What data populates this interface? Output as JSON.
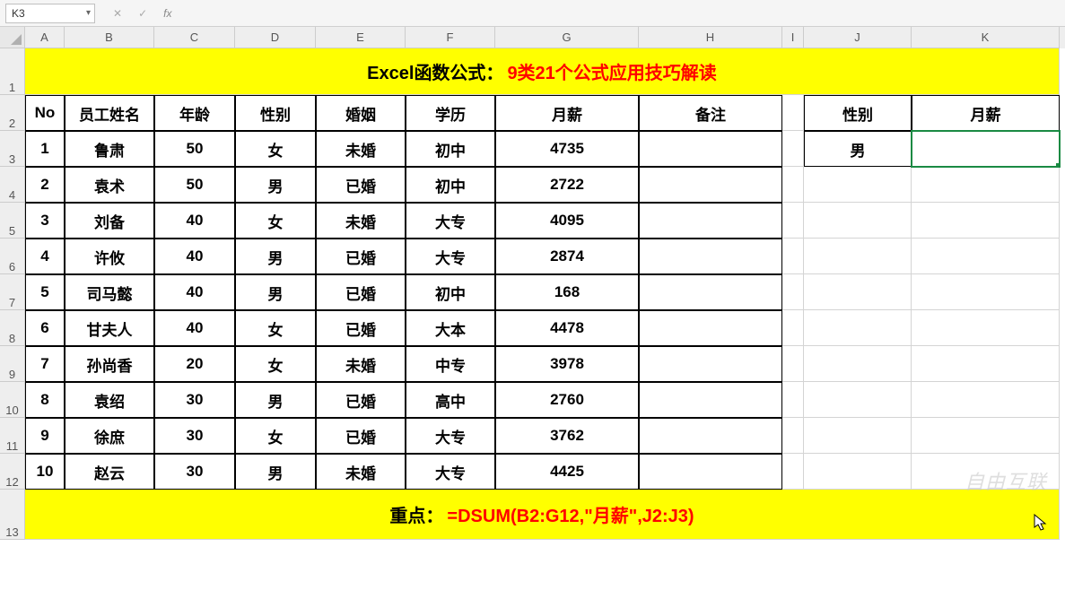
{
  "name_box": "K3",
  "banner": {
    "left": "Excel函数公式：",
    "right": "9类21个公式应用技巧解读"
  },
  "columns": [
    "A",
    "B",
    "C",
    "D",
    "E",
    "F",
    "G",
    "H",
    "I",
    "J",
    "K"
  ],
  "row_labels": [
    "1",
    "2",
    "3",
    "4",
    "5",
    "6",
    "7",
    "8",
    "9",
    "10",
    "11",
    "12",
    "13"
  ],
  "headers": {
    "A": "No",
    "B": "员工姓名",
    "C": "年龄",
    "D": "性别",
    "E": "婚姻",
    "F": "学历",
    "G": "月薪",
    "H": "备注"
  },
  "side_headers": {
    "J": "性别",
    "K": "月薪"
  },
  "side_value": "男",
  "data": [
    {
      "no": "1",
      "name": "鲁肃",
      "age": "50",
      "sex": "女",
      "mar": "未婚",
      "edu": "初中",
      "sal": "4735",
      "note": ""
    },
    {
      "no": "2",
      "name": "袁术",
      "age": "50",
      "sex": "男",
      "mar": "已婚",
      "edu": "初中",
      "sal": "2722",
      "note": ""
    },
    {
      "no": "3",
      "name": "刘备",
      "age": "40",
      "sex": "女",
      "mar": "未婚",
      "edu": "大专",
      "sal": "4095",
      "note": ""
    },
    {
      "no": "4",
      "name": "许攸",
      "age": "40",
      "sex": "男",
      "mar": "已婚",
      "edu": "大专",
      "sal": "2874",
      "note": ""
    },
    {
      "no": "5",
      "name": "司马懿",
      "age": "40",
      "sex": "男",
      "mar": "已婚",
      "edu": "初中",
      "sal": "168",
      "note": ""
    },
    {
      "no": "6",
      "name": "甘夫人",
      "age": "40",
      "sex": "女",
      "mar": "已婚",
      "edu": "大本",
      "sal": "4478",
      "note": ""
    },
    {
      "no": "7",
      "name": "孙尚香",
      "age": "20",
      "sex": "女",
      "mar": "未婚",
      "edu": "中专",
      "sal": "3978",
      "note": ""
    },
    {
      "no": "8",
      "name": "袁绍",
      "age": "30",
      "sex": "男",
      "mar": "已婚",
      "edu": "高中",
      "sal": "2760",
      "note": ""
    },
    {
      "no": "9",
      "name": "徐庶",
      "age": "30",
      "sex": "女",
      "mar": "已婚",
      "edu": "大专",
      "sal": "3762",
      "note": ""
    },
    {
      "no": "10",
      "name": "赵云",
      "age": "30",
      "sex": "男",
      "mar": "未婚",
      "edu": "大专",
      "sal": "4425",
      "note": ""
    }
  ],
  "formula": {
    "label": "重点：",
    "value": "=DSUM(B2:G12,\"月薪\",J2:J3)"
  },
  "watermark": "自由互联"
}
